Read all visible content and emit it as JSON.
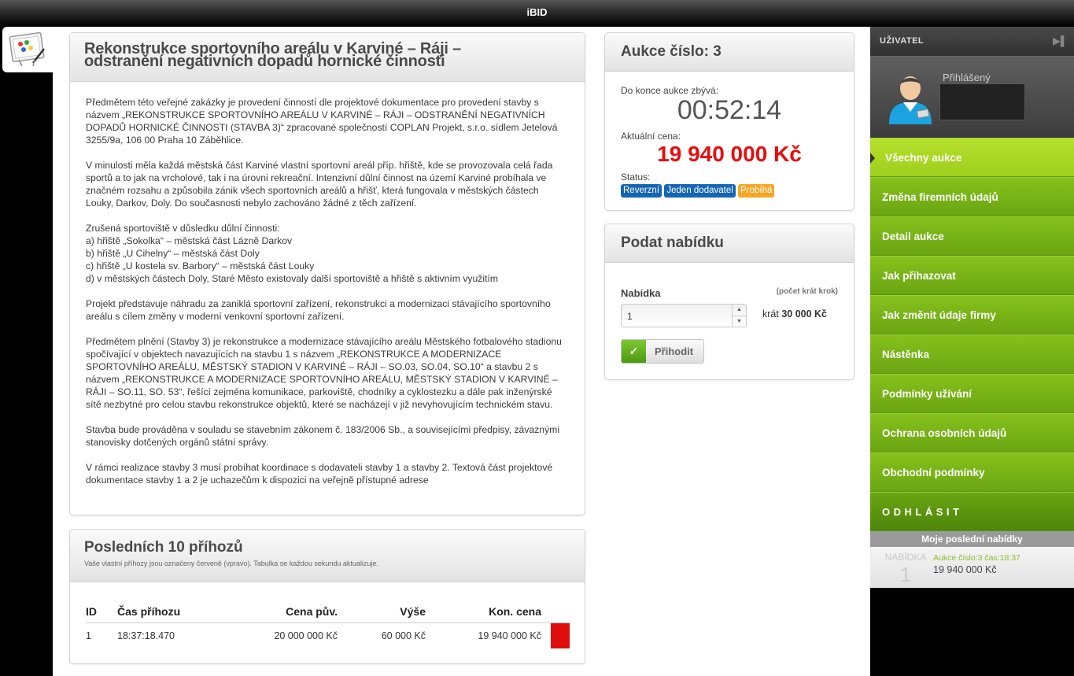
{
  "app": {
    "title": "iBID"
  },
  "description": {
    "title_line1": "Rekonstrukce sportovního areálu v Karviné – Ráji –",
    "title_line2": "odstranění negativních dopadů hornické činnosti",
    "paragraphs": [
      "Předmětem této veřejné zakázky je provedení činností dle projektové dokumentace pro provedení stavby s názvem „REKONSTRUKCE SPORTOVNÍHO AREÁLU V KARVINÉ – RÁJI – ODSTRANĚNÍ NEGATIVNÍCH DOPADŮ HORNICKÉ ČINNOSTI (STAVBA 3)“ zpracované společností COPLAN Projekt, s.r.o. sídlem Jetelová 3255/9a, 106 00 Praha 10 Záběhlice.",
      "V minulosti měla každá městská část Karviné vlastní sportovní areál příp. hřiště, kde se provozovala celá řada sportů a to jak na vrcholové, tak i na úrovni rekreační. Intenzivní důlní činnost na území Karviné probíhala ve značném rozsahu a způsobila zánik všech sportovních areálů a hřišť, která fungovala v městských částech Louky, Darkov, Doly. Do současnosti nebylo zachováno žádné z těch zařízení.",
      "Zrušená sportoviště v důsledku důlní činnosti:\na) hřiště „Sokolka“ – městská část Lázně Darkov\nb) hřiště „U Cihelny“ – městská část Doly\nc) hřiště „U kostela sv. Barbory“ – městská část Louky\nd) v městských částech Doly, Staré Město existovaly další sportoviště a hřiště s aktivním využitím",
      "Projekt představuje náhradu za zaniklá sportovní zařízení, rekonstrukci a modernizaci stávajícího sportovního areálu s cílem změny v moderní venkovní sportovní zařízení.",
      "Předmětem plnění (Stavby 3) je rekonstrukce a modernizace stávajícího areálu Městského fotbalového stadionu spočívající v objektech navazujících na stavbu 1 s názvem „REKONSTRUKCE A MODERNIZACE SPORTOVNÍHO AREÁLU, MĚSTSKÝ STADION V KARVINÉ – RÁJI – SO.03, SO.04, SO.10“ a stavbu 2 s názvem „REKONSTRUKCE A MODERNIZACE SPORTOVNÍHO AREÁLU, MĚSTSKÝ STADION V KARVINÉ – RÁJI – SO.11, SO. 53“, řešící zejména komunikace, parkoviště, chodníky a cyklostezku a dále pak inženýrské sítě nezbytné pro celou stavbu rekonstrukce objektů, které se nacházejí v již nevyhovujícím technickém stavu.",
      "Stavba bude prováděna v souladu se stavebním zákonem č. 183/2006 Sb., a souvisejícími předpisy, závaznými stanovisky dotčených orgánů státní správy.",
      "V rámci realizace stavby 3 musí probíhat koordinace s dodavateli stavby 1 a stavby 2. Textová část projektové dokumentace stavby 1 a 2 je uchazečům k dispozici na veřejně přístupné adrese"
    ]
  },
  "bids": {
    "title": "Posledních 10 příhozů",
    "subtitle": "Vaše vlastní příhozy jsou označeny červeně (vpravo). Tabulka se každou sekundu aktualizuje.",
    "columns": [
      "ID",
      "Čas příhozu",
      "Cena pův.",
      "Výše",
      "Kon. cena"
    ],
    "rows": [
      {
        "id": "1",
        "time": "18:37:18.470",
        "orig": "20 000 000 Kč",
        "amount": "60 000 Kč",
        "final": "19 940 000 Kč",
        "own": true
      }
    ],
    "own_color": "#e00d0d"
  },
  "auction": {
    "title": "Aukce číslo: 3",
    "remaining_label": "Do konce aukce zbývá:",
    "timer": "00:52:14",
    "price_label": "Aktuální cena:",
    "price": "19 940 000 Kč",
    "status_label": "Status:",
    "badges": [
      {
        "label": "Reverzní",
        "color": "#1565b5"
      },
      {
        "label": "Jeden dodavatel",
        "color": "#1565b5"
      },
      {
        "label": "Probíhá",
        "color": "#f5a623"
      }
    ]
  },
  "offer": {
    "title": "Podat nabídku",
    "label": "Nabídka",
    "hint": "(počet krát krok)",
    "value": "1",
    "times_prefix": "krát",
    "step": "30 000 Kč",
    "button": "Přihodit"
  },
  "sidebar": {
    "user_heading": "UŽIVATEL",
    "logged_label": "Přihlášený",
    "menu": [
      {
        "label": "Všechny aukce",
        "active": true
      },
      {
        "label": "Změna firemních údajů"
      },
      {
        "label": "Detail aukce"
      },
      {
        "label": "Jak přihazovat"
      },
      {
        "label": "Jak změnit údaje firmy"
      },
      {
        "label": "Nástěnka"
      },
      {
        "label": "Podmínky užívání"
      },
      {
        "label": "Ochrana osobních údajů"
      },
      {
        "label": "Obchodní podmínky"
      }
    ],
    "logout": "ODHLÁSIT",
    "recent": {
      "heading": "Moje poslední nabídky",
      "label": "NABÍDKA",
      "number": "1",
      "line1": "Aukce číslo:3 čas:18:37",
      "line2": "19 940 000 Kč"
    }
  }
}
